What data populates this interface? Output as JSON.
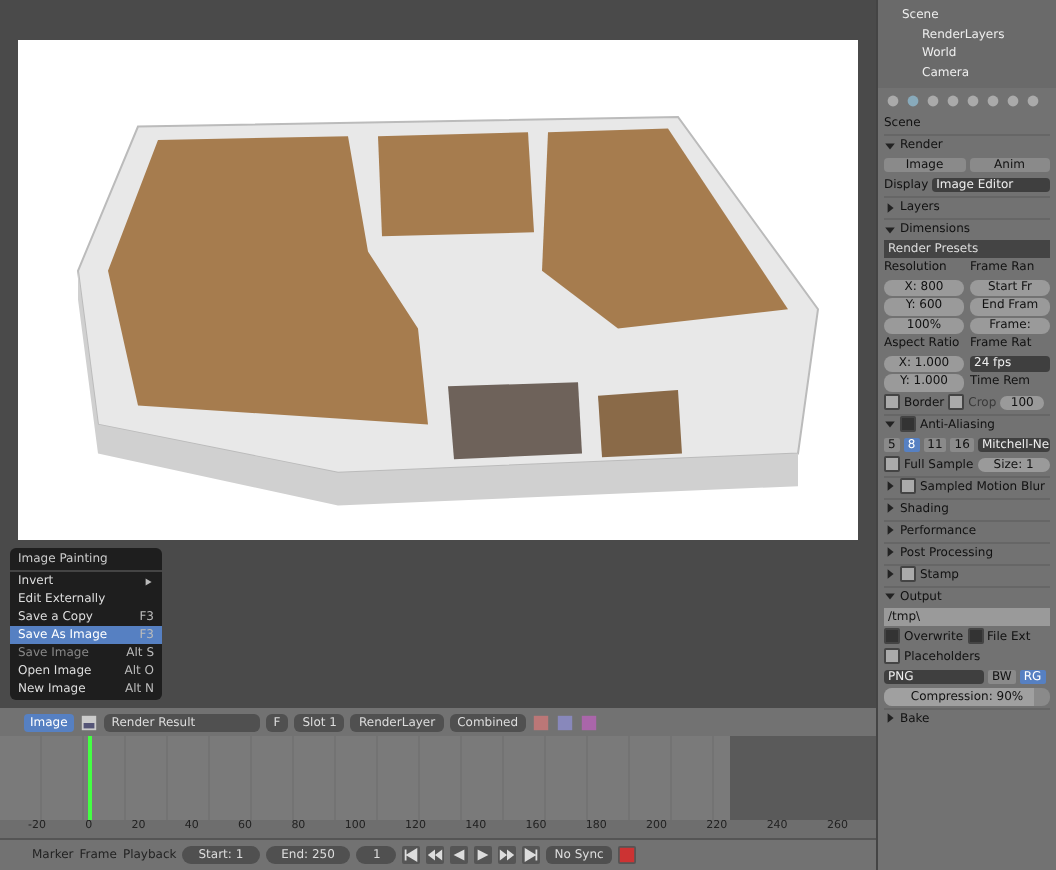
{
  "menu": {
    "title": "Image Painting",
    "items": [
      {
        "label": "Invert",
        "submenu": true,
        "selected": false,
        "disabled": false
      },
      {
        "label": "Edit Externally",
        "submenu": false,
        "selected": false,
        "disabled": false
      },
      {
        "label": "Save a Copy",
        "shortcut": "F3",
        "submenu": false,
        "selected": false,
        "disabled": false
      },
      {
        "label": "Save As Image",
        "shortcut": "F3",
        "submenu": false,
        "selected": true,
        "disabled": false
      },
      {
        "label": "Save Image",
        "shortcut": "Alt S",
        "submenu": false,
        "selected": false,
        "disabled": true
      },
      {
        "label": "Open Image",
        "shortcut": "Alt O",
        "submenu": false,
        "selected": false,
        "disabled": false
      },
      {
        "label": "New Image",
        "shortcut": "Alt N",
        "submenu": false,
        "selected": false,
        "disabled": false
      }
    ]
  },
  "image_header": {
    "menu": "Image",
    "image_name": "Render Result",
    "fake_user": "F",
    "slot": "Slot 1",
    "layer": "RenderLayer",
    "pass": "Combined"
  },
  "timeline": {
    "ruler": [
      "-20",
      "0",
      "20",
      "40",
      "60",
      "80",
      "100",
      "120",
      "140",
      "160",
      "180",
      "200",
      "220",
      "240",
      "260"
    ],
    "menus": [
      "Marker",
      "Frame",
      "Playback"
    ],
    "start": "Start: 1",
    "end": "End: 250",
    "current": "1",
    "sync": "No Sync"
  },
  "outliner": [
    {
      "label": "Scene",
      "children": [
        {
          "label": "RenderLayers"
        },
        {
          "label": "World"
        },
        {
          "label": "Camera"
        }
      ]
    }
  ],
  "properties": {
    "context": "Scene",
    "render": {
      "title": "Render",
      "expanded": true,
      "buttons": [
        "Image",
        "Anim"
      ],
      "display_label": "Display",
      "display_value": "Image Editor"
    },
    "layers": {
      "title": "Layers",
      "expanded": false
    },
    "dimensions": {
      "title": "Dimensions",
      "expanded": true,
      "presets": "Render Presets",
      "left": [
        {
          "kind": "label",
          "text": "Resolution"
        },
        {
          "kind": "field",
          "text": "X: 800"
        },
        {
          "kind": "field",
          "text": "Y: 600"
        },
        {
          "kind": "field",
          "text": "100%"
        },
        {
          "kind": "label",
          "text": "Aspect Ratio"
        },
        {
          "kind": "field",
          "text": "X: 1.000"
        },
        {
          "kind": "field",
          "text": "Y: 1.000"
        }
      ],
      "right": [
        {
          "kind": "label",
          "text": "Frame Ran"
        },
        {
          "kind": "field",
          "text": "Start Fr"
        },
        {
          "kind": "field",
          "text": "End Fram"
        },
        {
          "kind": "field",
          "text": "Frame:"
        },
        {
          "kind": "label",
          "text": "Frame Rat"
        },
        {
          "kind": "menu",
          "text": "24 fps"
        },
        {
          "kind": "label",
          "text": "Time Rem"
        }
      ],
      "border": {
        "label": "Border",
        "checked": false
      },
      "crop": {
        "label": "Crop",
        "checked": false
      },
      "old": "100"
    },
    "anti_aliasing": {
      "title": "Anti-Aliasing",
      "expanded": true,
      "checked": true,
      "samples": [
        {
          "label": "5",
          "selected": false
        },
        {
          "label": "8",
          "selected": true
        },
        {
          "label": "11",
          "selected": false
        },
        {
          "label": "16",
          "selected": false
        }
      ],
      "filter": "Mitchell-Ne",
      "full_sample": {
        "label": "Full Sample",
        "checked": false
      },
      "size": "Size: 1"
    },
    "collapsed": [
      {
        "title": "Sampled Motion Blur",
        "expanded": false,
        "checked": false
      },
      {
        "title": "Shading",
        "expanded": false
      },
      {
        "title": "Performance",
        "expanded": false
      },
      {
        "title": "Post Processing",
        "expanded": false
      },
      {
        "title": "Stamp",
        "expanded": false,
        "checked": false
      }
    ],
    "output": {
      "title": "Output",
      "expanded": true,
      "path": "/tmp\\",
      "overwrite": {
        "label": "Overwrite",
        "checked": true
      },
      "file_ext": {
        "label": "File Ext",
        "checked": true
      },
      "placeholders": {
        "label": "Placeholders",
        "checked": false
      },
      "format": "PNG",
      "color_modes": [
        {
          "label": "BW",
          "selected": false
        },
        {
          "label": "RG",
          "selected": true
        }
      ],
      "compression": {
        "label": "Compression: 90%",
        "level": 0.9
      }
    },
    "bake": {
      "title": "Bake",
      "expanded": false
    }
  }
}
